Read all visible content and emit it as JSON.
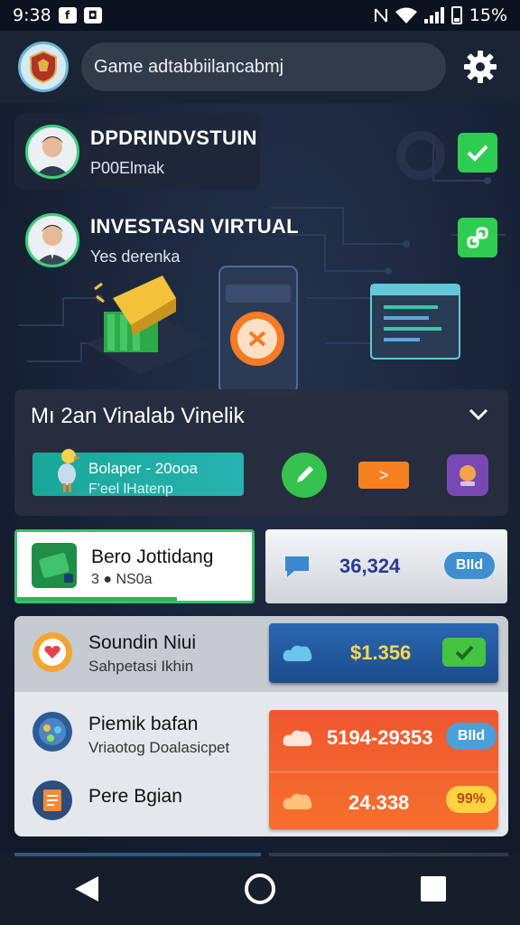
{
  "status_bar": {
    "time": "9:38",
    "battery_text": "15%"
  },
  "header": {
    "search_text": "Game adtabbiilancabmj",
    "settings_icon": "gear-icon"
  },
  "profile_cards": [
    {
      "title": "DPDRINDVSTUIN",
      "subtitle": "P00Elmak",
      "status_icon": "check-icon"
    },
    {
      "title": "INVESTASN VIRTUAL",
      "subtitle": "Yes derenka",
      "status_icon": "link-icon"
    }
  ],
  "section": {
    "title": "Mı 2an Vinalab Vinelik",
    "banner_line1": "Bolaper - 20ooa",
    "banner_line2": "F'eel lHatenp",
    "next_label": ">"
  },
  "summary": {
    "left_title": "Bero Jottidang",
    "left_sub": "3 ● NS0a",
    "left_progress": 0.68,
    "right_value": "36,324",
    "right_button": "BIId"
  },
  "list": [
    {
      "title": "Soundin Niui",
      "subtitle": "Sahpetasi Ikhin",
      "value": "$1.356",
      "action": "check"
    },
    {
      "title": "Piemik bafan",
      "subtitle": "Vriaotog Doalasicpet",
      "value": "5194-29353",
      "action": "BIId"
    },
    {
      "title": "Pere Bgian",
      "subtitle": "",
      "value": "24.338",
      "action": "99%"
    }
  ],
  "colors": {
    "accent_green": "#2fcc52",
    "accent_orange": "#f78120",
    "accent_blue": "#2a67b1",
    "background": "#161f33"
  }
}
